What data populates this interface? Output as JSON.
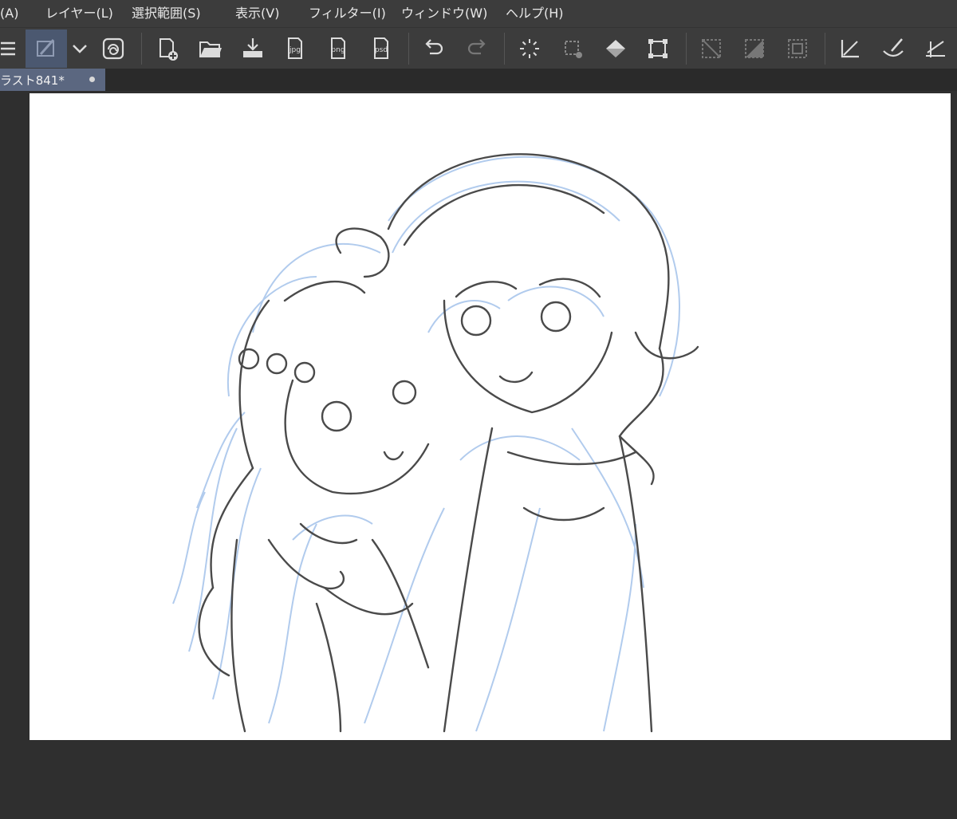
{
  "menu": {
    "items": [
      {
        "label": "(A)"
      },
      {
        "label": "レイヤー(L)"
      },
      {
        "label": "選択範囲(S)"
      },
      {
        "label": "表示(V)"
      },
      {
        "label": "フィルター(I)"
      },
      {
        "label": "ウィンドウ(W)"
      },
      {
        "label": "ヘルプ(H)"
      }
    ]
  },
  "toolbar": {
    "icons": {
      "menu": "hamburger-icon",
      "active_tool": "brush-icon",
      "dropdown": "chevron-down-icon",
      "logo": "clip-studio-icon",
      "new": "new-file-icon",
      "open": "open-folder-icon",
      "save": "save-icon",
      "export_jpg": "export-jpg-icon",
      "export_png": "export-png-icon",
      "export_psd": "export-psd-icon",
      "undo": "undo-icon",
      "redo": "redo-icon",
      "loading": "spinner-icon",
      "select": "selection-icon",
      "fill": "fill-icon",
      "transform": "transform-icon",
      "deselect": "deselect-icon",
      "invert": "invert-selection-icon",
      "border": "selection-border-icon",
      "ruler": "ruler-icon",
      "pen": "pen-curve-icon",
      "perspective": "perspective-ruler-icon"
    },
    "labels": {
      "jpg": "jpg",
      "png": "png",
      "psd": "psd"
    }
  },
  "document": {
    "tab_title": "ラスト841*"
  },
  "colors": {
    "ui_bg": "#3c3c3c",
    "workspace_bg": "#2f2f2f",
    "active_tab": "#5b6780",
    "sketch_dark": "#4a4a4a",
    "sketch_blue": "#a9c6ec"
  }
}
